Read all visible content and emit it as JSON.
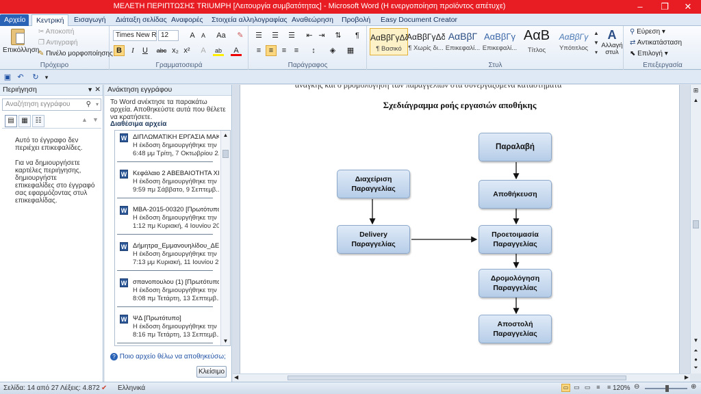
{
  "window": {
    "title": "ΜΕΛΕΤΗ ΠΕΡΙΠΤΩΣΗΣ TRIUMPH [Λειτουργία συμβατότητας] - Microsoft Word (Η ενεργοποίηση προϊόντος απέτυχε)",
    "minimize": "–",
    "maximize": "❐",
    "close": "✕",
    "title_color": "#e81c23"
  },
  "ribbon_tabs": [
    "Αρχείο",
    "Κεντρική",
    "Εισαγωγή",
    "Διάταξη σελίδας",
    "Αναφορές",
    "Στοιχεία αλληλογραφίας",
    "Αναθεώρηση",
    "Προβολή",
    "Easy Document Creator"
  ],
  "clipboard": {
    "paste": "Επικόλληση",
    "cut": "Αποκοπή",
    "copy": "Αντιγραφή",
    "format_painter": "Πινέλο μορφοποίησης",
    "label": "Πρόχειρο"
  },
  "font": {
    "name": "Times New Rom",
    "size": "12",
    "label": "Γραμματοσειρά",
    "grow": "A",
    "shrink": "A",
    "case": "Aa",
    "bold": "B",
    "italic": "I",
    "underline": "U",
    "strike": "abc",
    "subscript": "x₂",
    "superscript": "x²",
    "highlight": "ab",
    "color": "A"
  },
  "paragraph": {
    "label": "Παράγραφος",
    "pilcrow": "¶"
  },
  "styles": {
    "label": "Στυλ",
    "change_styles": "Αλλαγή στυλ",
    "items": [
      {
        "sample": "ΑαΒβΓγΔδ",
        "name": "¶ Βασικό"
      },
      {
        "sample": "ΑαΒβΓγΔδ",
        "name": "¶ Χωρίς δι..."
      },
      {
        "sample": "ΑαΒβΓ",
        "name": "Επικεφαλί..."
      },
      {
        "sample": "ΑαΒβΓγ",
        "name": "Επικεφαλί..."
      },
      {
        "sample": "ΑαΒ",
        "name": "Τίτλος"
      },
      {
        "sample": "ΑαΒβΓγ",
        "name": "Υπότιτλος"
      }
    ]
  },
  "editing": {
    "label": "Επεξεργασία",
    "find": "Εύρεση",
    "replace": "Αντικατάσταση",
    "select": "Επιλογή"
  },
  "nav_pane": {
    "title": "Περιήγηση",
    "search_placeholder": "Αναζήτηση εγγράφου",
    "message": "Αυτό το έγγραφο δεν περιέχει επικεφαλίδες.",
    "message2": "Για να δημιουργήσετε καρτέλες περιήγησης, δημιουργήστε επικεφαλίδες στο έγγραφό σας εφαρμόζοντας στυλ επικεφαλίδας."
  },
  "recovery": {
    "title": "Ανάκτηση εγγράφου",
    "intro": "Το Word ανέκτησε τα παρακάτω αρχεία. Αποθηκεύστε αυτά που θέλετε να κρατήσετε.",
    "available_label": "Διαθέσιμα αρχεία",
    "files": [
      {
        "name": "ΔΙΠΛΩΜΑΤΙΚΗ ΕΡΓΑΣΙΑ ΜΑΚ...",
        "desc": "Η έκδοση δημιουργήθηκε την ...",
        "date": "6:48 μμ Τρίτη, 7 Οκτωβρίου 2..."
      },
      {
        "name": "Κεφάλαιο 2 ΑΒΕΒΑΙΟΤΗΤΑ ΧΙ...",
        "desc": "Η έκδοση δημιουργήθηκε την ...",
        "date": "9:59 πμ Σάββατο, 9 Σεπτεμβ..."
      },
      {
        "name": "MBA-2015-00320  [Πρωτότυπο]",
        "desc": "Η έκδοση δημιουργήθηκε την ...",
        "date": "1:12 πμ Κυριακή, 4 Ιουνίου 2017"
      },
      {
        "name": "Δήμητρα_Εμμανουηλίδου_ΔΕ...",
        "desc": "Η έκδοση δημιουργήθηκε την ...",
        "date": "7:13 μμ Κυριακή, 11 Ιουνίου 2..."
      },
      {
        "name": "σπανοπουλου (1)  [Πρωτότυπο]",
        "desc": "Η έκδοση δημιουργήθηκε την ...",
        "date": "8:08 πμ Τετάρτη, 13 Σεπτεμβ..."
      },
      {
        "name": "ΨΔ  [Πρωτότυπο]",
        "desc": "Η έκδοση δημιουργήθηκε την ...",
        "date": "8:16 πμ Τετάρτη, 13 Σεπτεμβ..."
      }
    ],
    "help_link": "Ποιο αρχείο θέλω να αποθηκεύσω;",
    "close_button": "Κλείσιμο"
  },
  "document": {
    "cutoff_text": "ανάγκης και ο βρομολόγηση των παραγγελιών στα συνεργαζόμενα καταστήματα",
    "diagram_title": "Σχεδιάγραμμα ροής εργασιών αποθήκης",
    "boxes": {
      "receive": "Παραλαβή",
      "storage": "Αποθήκευση",
      "prepare": "Προετοιμασία Παραγγελίας",
      "routing": "Δρομολόγηση Παραγγελίας",
      "dispatch": "Αποστολή Παραγγελίας",
      "manage": "Διαχείριση Παραγγελίας",
      "delivery": "Delivery Παραγγελίας"
    }
  },
  "statusbar": {
    "page": "Σελίδα: 14 από 27",
    "words": "Λέξεις: 4.872",
    "language": "Ελληνικά",
    "zoom": "120%"
  }
}
